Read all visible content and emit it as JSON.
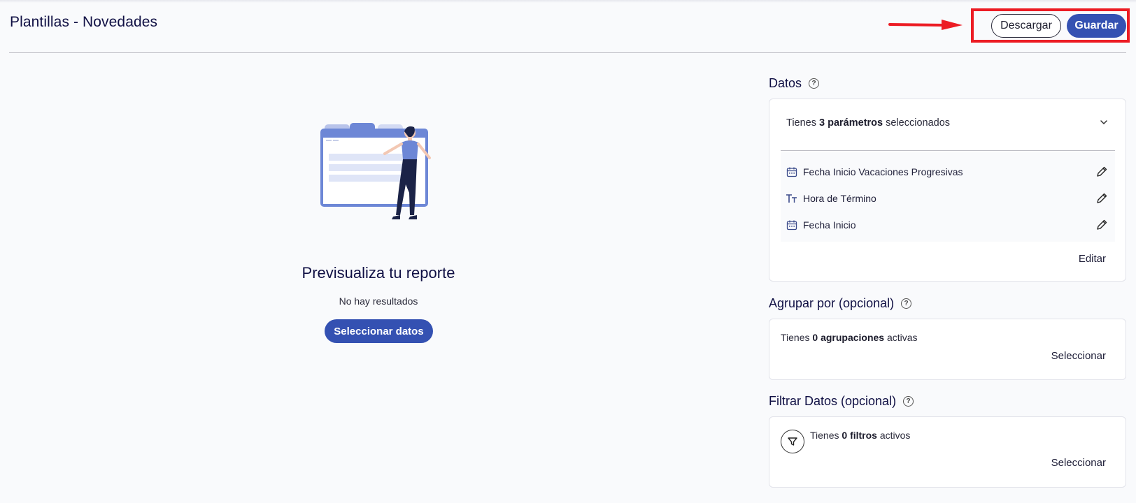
{
  "header": {
    "title": "Plantillas - Novedades",
    "download_label": "Descargar",
    "save_label": "Guardar"
  },
  "empty_state": {
    "title": "Previsualiza tu reporte",
    "subtitle": "No hay resultados",
    "select_data_label": "Seleccionar datos"
  },
  "datos": {
    "title": "Datos",
    "summary_prefix": "Tienes ",
    "summary_bold": "3 parámetros",
    "summary_suffix": " seleccionados",
    "params": [
      {
        "label": "Fecha Inicio Vacaciones Progresivas",
        "icon": "calendar-icon"
      },
      {
        "label": "Hora de Término",
        "icon": "text-type-icon"
      },
      {
        "label": "Fecha Inicio",
        "icon": "calendar-icon"
      }
    ],
    "edit_label": "Editar"
  },
  "agrupar": {
    "title": "Agrupar por (opcional)",
    "summary_prefix": "Tienes ",
    "summary_bold": "0 agrupaciones",
    "summary_suffix": " activas",
    "select_label": "Seleccionar"
  },
  "filtrar": {
    "title": "Filtrar Datos (opcional)",
    "summary_prefix": "Tienes ",
    "summary_bold": "0 filtros",
    "summary_suffix": " activos",
    "select_label": "Seleccionar"
  },
  "colors": {
    "primary": "#3451b2",
    "annotation_red": "#ec1c24",
    "title_navy": "#101044"
  }
}
